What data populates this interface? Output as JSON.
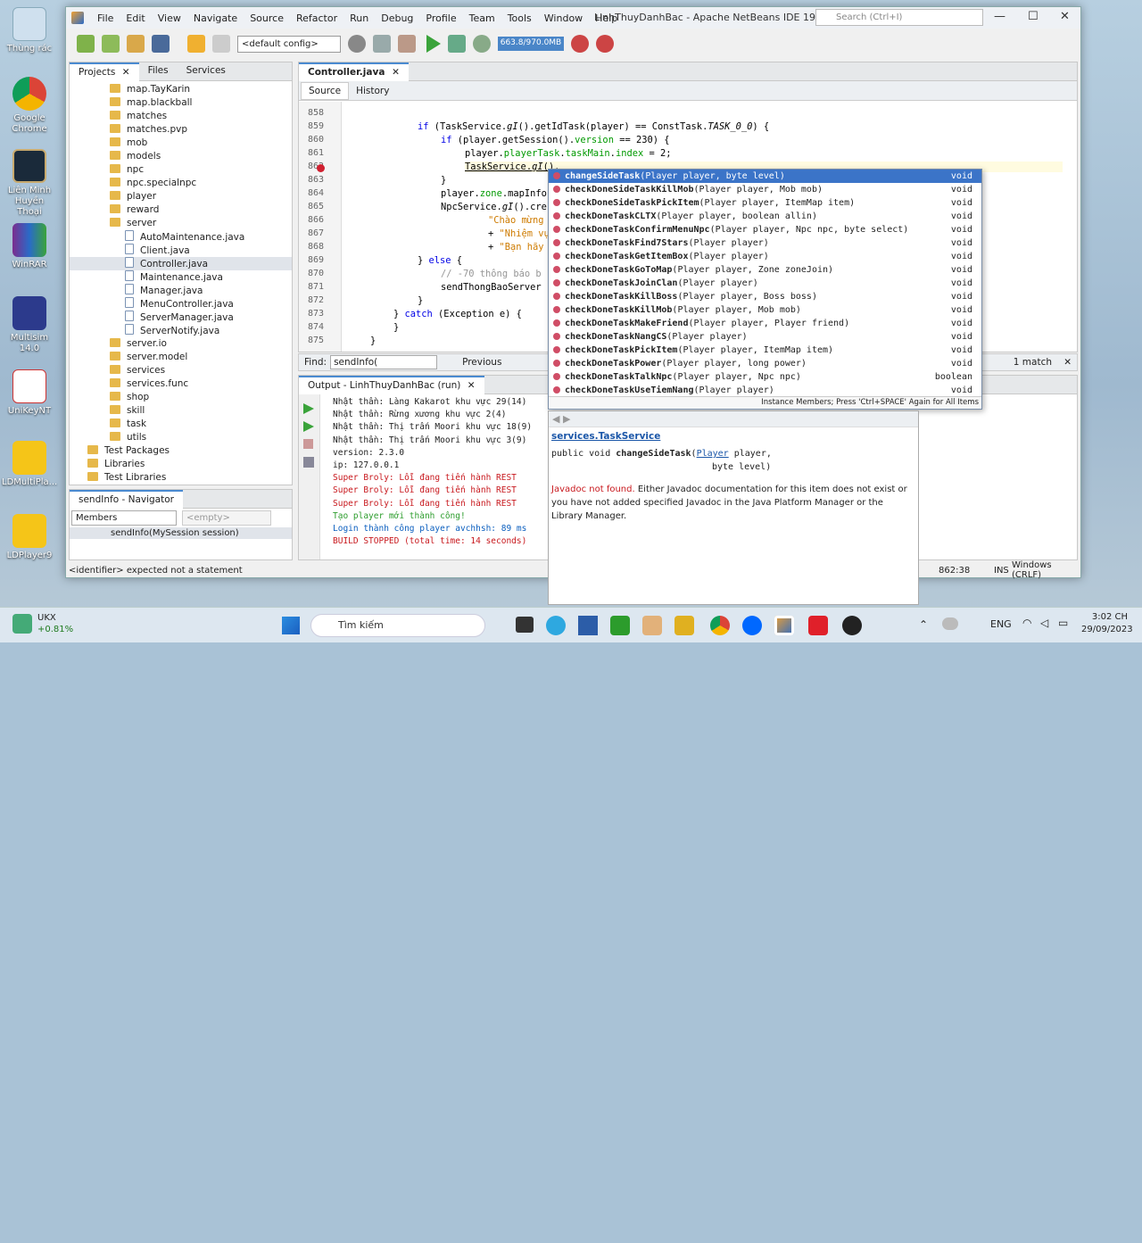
{
  "desktop": {
    "icons": [
      "Thùng rác",
      "Google Chrome",
      "Liên Minh Huyền Thoại",
      "WinRAR",
      "Multisim 14.0",
      "UniKeyNT",
      "LDMultiPla...",
      "LDPlayer9"
    ]
  },
  "window": {
    "title": "LinhThuyDanhBac - Apache NetBeans IDE 19",
    "search_placeholder": "Search (Ctrl+I)",
    "menu": [
      "File",
      "Edit",
      "View",
      "Navigate",
      "Source",
      "Refactor",
      "Run",
      "Debug",
      "Profile",
      "Team",
      "Tools",
      "Window",
      "Help"
    ]
  },
  "toolbar": {
    "config": "<default config>",
    "memory": "663.8/970.0MB"
  },
  "projects": {
    "tabs": [
      "Projects",
      "Files",
      "Services"
    ],
    "items": [
      {
        "t": "map.TayKarin",
        "d": 2,
        "k": "f"
      },
      {
        "t": "map.blackball",
        "d": 2,
        "k": "f"
      },
      {
        "t": "matches",
        "d": 2,
        "k": "f"
      },
      {
        "t": "matches.pvp",
        "d": 2,
        "k": "f"
      },
      {
        "t": "mob",
        "d": 2,
        "k": "f"
      },
      {
        "t": "models",
        "d": 2,
        "k": "f"
      },
      {
        "t": "npc",
        "d": 2,
        "k": "f"
      },
      {
        "t": "npc.specialnpc",
        "d": 2,
        "k": "f"
      },
      {
        "t": "player",
        "d": 2,
        "k": "f"
      },
      {
        "t": "reward",
        "d": 2,
        "k": "f"
      },
      {
        "t": "server",
        "d": 2,
        "k": "f"
      },
      {
        "t": "AutoMaintenance.java",
        "d": 3,
        "k": "j"
      },
      {
        "t": "Client.java",
        "d": 3,
        "k": "j"
      },
      {
        "t": "Controller.java",
        "d": 3,
        "k": "j",
        "sel": true
      },
      {
        "t": "Maintenance.java",
        "d": 3,
        "k": "j"
      },
      {
        "t": "Manager.java",
        "d": 3,
        "k": "j"
      },
      {
        "t": "MenuController.java",
        "d": 3,
        "k": "j"
      },
      {
        "t": "ServerManager.java",
        "d": 3,
        "k": "j"
      },
      {
        "t": "ServerNotify.java",
        "d": 3,
        "k": "j"
      },
      {
        "t": "server.io",
        "d": 2,
        "k": "f"
      },
      {
        "t": "server.model",
        "d": 2,
        "k": "f"
      },
      {
        "t": "services",
        "d": 2,
        "k": "f"
      },
      {
        "t": "services.func",
        "d": 2,
        "k": "f"
      },
      {
        "t": "shop",
        "d": 2,
        "k": "f"
      },
      {
        "t": "skill",
        "d": 2,
        "k": "f"
      },
      {
        "t": "task",
        "d": 2,
        "k": "f"
      },
      {
        "t": "utils",
        "d": 2,
        "k": "f"
      },
      {
        "t": "Test Packages",
        "d": 1,
        "k": "f"
      },
      {
        "t": "Libraries",
        "d": 1,
        "k": "f"
      },
      {
        "t": "Test Libraries",
        "d": 1,
        "k": "f"
      }
    ]
  },
  "navigator": {
    "title": "sendInfo - Navigator",
    "filter": "Members",
    "empty": "<empty>",
    "member": "sendInfo(MySession session)"
  },
  "editor": {
    "tab": "Controller.java",
    "source": "Source",
    "history": "History",
    "lines": [
      "858",
      "859",
      "860",
      "861",
      "862",
      "863",
      "864",
      "865",
      "866",
      "867",
      "868",
      "869",
      "870",
      "871",
      "872",
      "873",
      "874",
      "875"
    ]
  },
  "find": {
    "label": "Find:",
    "value": "sendInfo(",
    "previous": "Previous",
    "matches": "1 match"
  },
  "completion": {
    "items": [
      {
        "n": "changeSideTask",
        "p": "(Player player, byte level)",
        "r": "void"
      },
      {
        "n": "checkDoneSideTaskKillMob",
        "p": "(Player player, Mob mob)",
        "r": "void"
      },
      {
        "n": "checkDoneSideTaskPickItem",
        "p": "(Player player, ItemMap item)",
        "r": "void"
      },
      {
        "n": "checkDoneTaskCLTX",
        "p": "(Player player, boolean allin)",
        "r": "void"
      },
      {
        "n": "checkDoneTaskConfirmMenuNpc",
        "p": "(Player player, Npc npc, byte select)",
        "r": "void"
      },
      {
        "n": "checkDoneTaskFind7Stars",
        "p": "(Player player)",
        "r": "void"
      },
      {
        "n": "checkDoneTaskGetItemBox",
        "p": "(Player player)",
        "r": "void"
      },
      {
        "n": "checkDoneTaskGoToMap",
        "p": "(Player player, Zone zoneJoin)",
        "r": "void"
      },
      {
        "n": "checkDoneTaskJoinClan",
        "p": "(Player player)",
        "r": "void"
      },
      {
        "n": "checkDoneTaskKillBoss",
        "p": "(Player player, Boss boss)",
        "r": "void"
      },
      {
        "n": "checkDoneTaskKillMob",
        "p": "(Player player, Mob mob)",
        "r": "void"
      },
      {
        "n": "checkDoneTaskMakeFriend",
        "p": "(Player player, Player friend)",
        "r": "void"
      },
      {
        "n": "checkDoneTaskNangCS",
        "p": "(Player player)",
        "r": "void"
      },
      {
        "n": "checkDoneTaskPickItem",
        "p": "(Player player, ItemMap item)",
        "r": "void"
      },
      {
        "n": "checkDoneTaskPower",
        "p": "(Player player, long power)",
        "r": "void"
      },
      {
        "n": "checkDoneTaskTalkNpc",
        "p": "(Player player, Npc npc)",
        "r": "boolean"
      },
      {
        "n": "checkDoneTaskUseTiemNang",
        "p": "(Player player)",
        "r": "void"
      }
    ],
    "footer": "Instance Members; Press 'Ctrl+SPACE' Again for All Items"
  },
  "javadoc": {
    "class": "services.TaskService",
    "sig1": "public void ",
    "sig_name": "changeSideTask",
    "sig_type": "Player",
    "sig_rest": " player,",
    "sig2": "byte level)",
    "not_found": "Javadoc not found.",
    "msg": " Either Javadoc documentation for this item does not exist or you have not added specified Javadoc in the Java Platform Manager or the Library Manager."
  },
  "output": {
    "title": "Output - LinhThuyDanhBac (run)",
    "lines": [
      {
        "t": "Nhật thần: Làng Kakarot khu vực 29(14)",
        "c": "#222"
      },
      {
        "t": "Nhật thần: Rừng xương khu vực 2(4)",
        "c": "#222"
      },
      {
        "t": "Nhật thần: Thị trấn Moori khu vực 18(9)",
        "c": "#222"
      },
      {
        "t": "Nhật thần: Thị trấn Moori khu vực 3(9)",
        "c": "#222"
      },
      {
        "t": "version: 2.3.0",
        "c": "#222"
      },
      {
        "t": "ip: 127.0.0.1",
        "c": "#222"
      },
      {
        "t": "Super Broly: Lỗi đang tiến hành REST",
        "c": "#c8191e"
      },
      {
        "t": "Super Broly: Lỗi đang tiến hành REST",
        "c": "#c8191e"
      },
      {
        "t": "Super Broly: Lỗi đang tiến hành REST",
        "c": "#c8191e"
      },
      {
        "t": "Tạo player mới thành công!",
        "c": "#2d9d2d"
      },
      {
        "t": "Login thành công player avchhsh: 89 ms",
        "c": "#0b5fbf"
      },
      {
        "t": "BUILD STOPPED (total time: 14 seconds)",
        "c": "#c8191e"
      }
    ]
  },
  "status": {
    "msg": "<identifier> expected  not a statement",
    "pos": "862:38",
    "ins": "INS",
    "enc": "Windows (CRLF)"
  },
  "taskbar": {
    "stock": "UKX",
    "change": "+0.81%",
    "search": "Tìm kiếm",
    "lang": "ENG",
    "time": "3:02 CH",
    "date": "29/09/2023"
  }
}
